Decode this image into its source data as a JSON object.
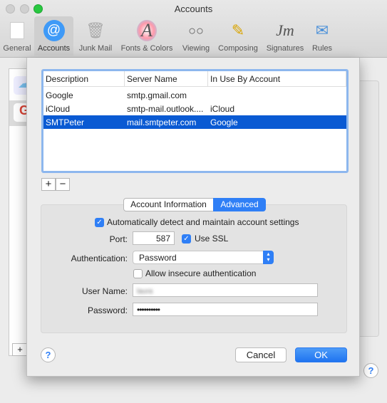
{
  "window": {
    "title": "Accounts"
  },
  "toolbar": {
    "items": [
      {
        "label": "General",
        "icon": "general-icon"
      },
      {
        "label": "Accounts",
        "icon": "at-icon",
        "selected": true
      },
      {
        "label": "Junk Mail",
        "icon": "junk-mail-icon"
      },
      {
        "label": "Fonts & Colors",
        "icon": "fonts-icon"
      },
      {
        "label": "Viewing",
        "icon": "glasses-icon"
      },
      {
        "label": "Composing",
        "icon": "pencil-icon"
      },
      {
        "label": "Signatures",
        "icon": "signature-icon"
      },
      {
        "label": "Rules",
        "icon": "rules-icon"
      }
    ]
  },
  "smtp_table": {
    "columns": [
      "Description",
      "Server Name",
      "In Use By Account"
    ],
    "rows": [
      {
        "description": "Google",
        "server": "smtp.gmail.com",
        "in_use": ""
      },
      {
        "description": "iCloud",
        "server": "smtp-mail.outlook....",
        "in_use": "iCloud"
      },
      {
        "description": "SMTPeter",
        "server": "mail.smtpeter.com",
        "in_use": "Google",
        "selected": true
      }
    ],
    "add": "+",
    "remove": "−"
  },
  "tabs": {
    "account_info": "Account Information",
    "advanced": "Advanced",
    "active": "Advanced"
  },
  "advanced": {
    "auto_detect": {
      "label": "Automatically detect and maintain account settings",
      "checked": true
    },
    "port_label": "Port:",
    "port": "587",
    "ssl": {
      "label": "Use SSL",
      "checked": true
    },
    "auth_label": "Authentication:",
    "auth_value": "Password",
    "insecure": {
      "label": "Allow insecure authentication",
      "checked": false
    },
    "user_label": "User Name:",
    "user_value": "laura",
    "password_label": "Password:",
    "password_value": "••••••••••"
  },
  "buttons": {
    "help": "?",
    "cancel": "Cancel",
    "ok": "OK",
    "add": "+"
  },
  "colors": {
    "accent": "#2f7ff6",
    "selection": "#0a5ad3"
  }
}
